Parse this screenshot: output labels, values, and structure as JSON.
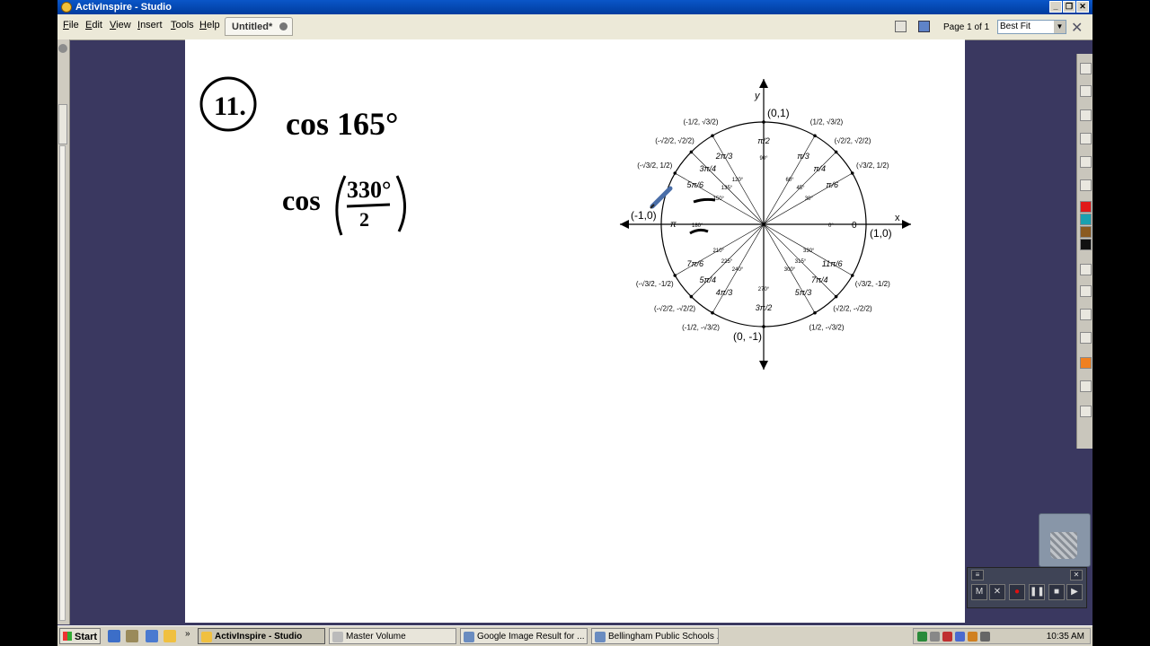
{
  "window": {
    "title": "ActivInspire - Studio"
  },
  "menu": [
    {
      "label": "File"
    },
    {
      "label": "Edit"
    },
    {
      "label": "View"
    },
    {
      "label": "Insert"
    },
    {
      "label": "Tools"
    },
    {
      "label": "Help"
    }
  ],
  "tab": {
    "label": "Untitled*"
  },
  "pager": {
    "label": "Page 1 of 1",
    "zoom": "Best Fit"
  },
  "handwriting": {
    "problem_number": "11.",
    "line1": "cos 165°",
    "line2_fn": "cos",
    "line2_num": "330°",
    "line2_den": "2"
  },
  "unit_circle": {
    "axis_x": "x",
    "axis_y": "y",
    "pt_0": "(1,0)",
    "pt_90": "(0,1)",
    "pt_180": "(-1,0)",
    "pt_270": "(0, -1)",
    "rad_0": "0",
    "rad_180": "π",
    "deg_0": "0°",
    "deg_180": "180°",
    "quadrant_labels": [
      {
        "coord": "(√3/2, 1/2)",
        "rad": "π/6",
        "deg": "30°"
      },
      {
        "coord": "(√2/2, √2/2)",
        "rad": "π/4",
        "deg": "45°"
      },
      {
        "coord": "(1/2, √3/2)",
        "rad": "π/3",
        "deg": "60°"
      },
      {
        "coord": "(0,1)",
        "rad": "π/2",
        "deg": "90°"
      },
      {
        "coord": "(-1/2, √3/2)",
        "rad": "2π/3",
        "deg": "120°"
      },
      {
        "coord": "(-√2/2, √2/2)",
        "rad": "3π/4",
        "deg": "135°"
      },
      {
        "coord": "(-√3/2, 1/2)",
        "rad": "5π/6",
        "deg": "150°"
      },
      {
        "coord": "(-√3/2, -1/2)",
        "rad": "7π/6",
        "deg": "210°"
      },
      {
        "coord": "(-√2/2, -√2/2)",
        "rad": "5π/4",
        "deg": "225°"
      },
      {
        "coord": "(-1/2, -√3/2)",
        "rad": "4π/3",
        "deg": "240°"
      },
      {
        "coord": "(0, -1)",
        "rad": "3π/2",
        "deg": "270°"
      },
      {
        "coord": "(1/2, -√3/2)",
        "rad": "5π/3",
        "deg": "300°"
      },
      {
        "coord": "(√2/2, -√2/2)",
        "rad": "7π/4",
        "deg": "315°"
      },
      {
        "coord": "(√3/2, -1/2)",
        "rad": "11π/6",
        "deg": "330°"
      }
    ]
  },
  "taskbar": {
    "start": "Start",
    "tasks": [
      {
        "label": "ActivInspire - Studio"
      },
      {
        "label": "Master Volume"
      },
      {
        "label": "Google Image Result for ..."
      },
      {
        "label": "Bellingham Public Schools ..."
      }
    ],
    "clock": "10:35 AM"
  },
  "colors": {
    "titlebar": "#0a56c8",
    "background": "#3a3860",
    "ink": "#000000"
  }
}
